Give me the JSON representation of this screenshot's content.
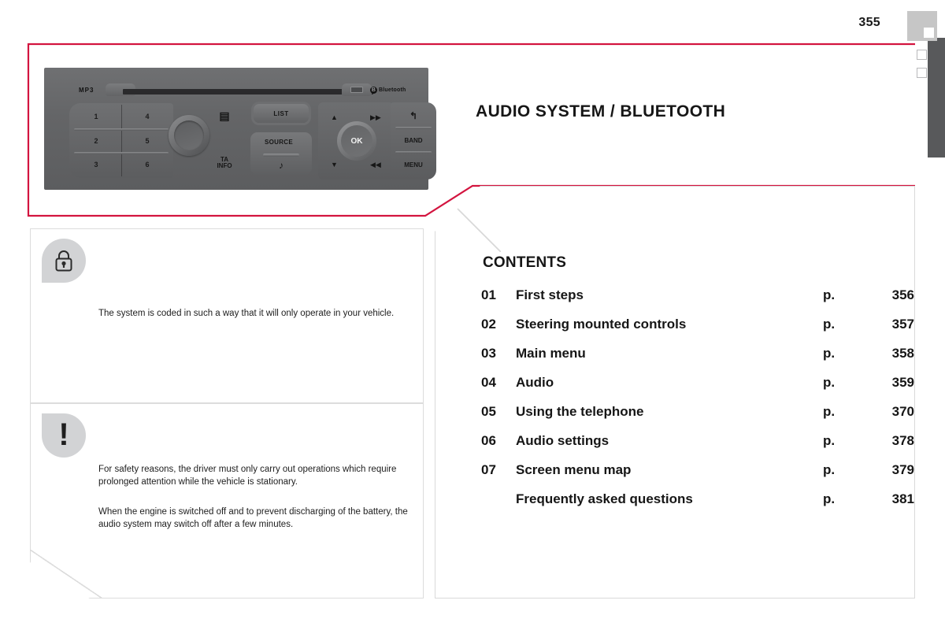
{
  "page": {
    "number": "355",
    "title": "AUDIO SYSTEM / BLUETOOTH"
  },
  "colors": {
    "accent_red": "#d3143f",
    "edge_tab_gray": "#58595b",
    "corner_block_gray": "#c6c6c6",
    "badge_gray": "#d2d3d5",
    "radio_body_gray": "#65666a"
  },
  "radio": {
    "label_mp3": "MP3",
    "label_bluetooth": "Bluetooth",
    "bluetooth_glyph": "B",
    "eject_glyph": "⏏",
    "presets": [
      "1",
      "4",
      "2",
      "5",
      "3",
      "6"
    ],
    "buttons": {
      "list": "LIST",
      "source": "SOURCE",
      "source_note_glyph": "♪",
      "ok": "OK",
      "band": "BAND",
      "menu": "MENU",
      "back_glyph": "↰",
      "ta_info_line1": "TA",
      "ta_info_line2": "INFO",
      "up_glyph": "▲",
      "down_glyph": "▼",
      "forward_glyph": "▶▶",
      "rewind_glyph": "◀◀",
      "dark_mode_glyph": "▤"
    }
  },
  "contents": {
    "heading": "CONTENTS",
    "page_prefix": "p.",
    "items": [
      {
        "number": "01",
        "label": "First steps",
        "prefix": "p.",
        "page": "356"
      },
      {
        "number": "02",
        "label": "Steering mounted controls",
        "prefix": "p.",
        "page": "357"
      },
      {
        "number": "03",
        "label": "Main menu",
        "prefix": "p.",
        "page": "358"
      },
      {
        "number": "04",
        "label": "Audio",
        "prefix": "p.",
        "page": "359"
      },
      {
        "number": "05",
        "label": "Using the telephone",
        "prefix": "p.",
        "page": "370"
      },
      {
        "number": "06",
        "label": "Audio settings",
        "prefix": "p.",
        "page": "378"
      },
      {
        "number": "07",
        "label": "Screen menu map",
        "prefix": "p.",
        "page": "379"
      },
      {
        "number": "",
        "label": "Frequently asked questions",
        "prefix": "p.",
        "page": "381"
      }
    ]
  },
  "notes": {
    "coding": {
      "icon": "lock-icon",
      "text": "The system is coded in such a way that it will only operate in your vehicle."
    },
    "safety": {
      "icon": "warning-icon",
      "paragraph1": "For safety reasons, the driver must only carry out operations which require prolonged attention while the vehicle is stationary.",
      "paragraph2": "When the engine is switched off and to prevent discharging of the battery, the audio system may switch off after a few minutes."
    }
  }
}
